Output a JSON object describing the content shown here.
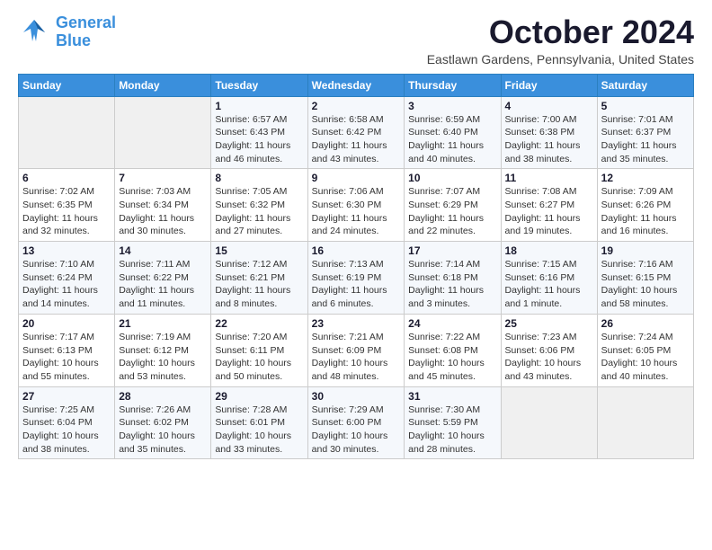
{
  "logo": {
    "line1": "General",
    "line2": "Blue"
  },
  "title": "October 2024",
  "location": "Eastlawn Gardens, Pennsylvania, United States",
  "weekdays": [
    "Sunday",
    "Monday",
    "Tuesday",
    "Wednesday",
    "Thursday",
    "Friday",
    "Saturday"
  ],
  "weeks": [
    [
      {
        "day": "",
        "info": ""
      },
      {
        "day": "",
        "info": ""
      },
      {
        "day": "1",
        "info": "Sunrise: 6:57 AM\nSunset: 6:43 PM\nDaylight: 11 hours and 46 minutes."
      },
      {
        "day": "2",
        "info": "Sunrise: 6:58 AM\nSunset: 6:42 PM\nDaylight: 11 hours and 43 minutes."
      },
      {
        "day": "3",
        "info": "Sunrise: 6:59 AM\nSunset: 6:40 PM\nDaylight: 11 hours and 40 minutes."
      },
      {
        "day": "4",
        "info": "Sunrise: 7:00 AM\nSunset: 6:38 PM\nDaylight: 11 hours and 38 minutes."
      },
      {
        "day": "5",
        "info": "Sunrise: 7:01 AM\nSunset: 6:37 PM\nDaylight: 11 hours and 35 minutes."
      }
    ],
    [
      {
        "day": "6",
        "info": "Sunrise: 7:02 AM\nSunset: 6:35 PM\nDaylight: 11 hours and 32 minutes."
      },
      {
        "day": "7",
        "info": "Sunrise: 7:03 AM\nSunset: 6:34 PM\nDaylight: 11 hours and 30 minutes."
      },
      {
        "day": "8",
        "info": "Sunrise: 7:05 AM\nSunset: 6:32 PM\nDaylight: 11 hours and 27 minutes."
      },
      {
        "day": "9",
        "info": "Sunrise: 7:06 AM\nSunset: 6:30 PM\nDaylight: 11 hours and 24 minutes."
      },
      {
        "day": "10",
        "info": "Sunrise: 7:07 AM\nSunset: 6:29 PM\nDaylight: 11 hours and 22 minutes."
      },
      {
        "day": "11",
        "info": "Sunrise: 7:08 AM\nSunset: 6:27 PM\nDaylight: 11 hours and 19 minutes."
      },
      {
        "day": "12",
        "info": "Sunrise: 7:09 AM\nSunset: 6:26 PM\nDaylight: 11 hours and 16 minutes."
      }
    ],
    [
      {
        "day": "13",
        "info": "Sunrise: 7:10 AM\nSunset: 6:24 PM\nDaylight: 11 hours and 14 minutes."
      },
      {
        "day": "14",
        "info": "Sunrise: 7:11 AM\nSunset: 6:22 PM\nDaylight: 11 hours and 11 minutes."
      },
      {
        "day": "15",
        "info": "Sunrise: 7:12 AM\nSunset: 6:21 PM\nDaylight: 11 hours and 8 minutes."
      },
      {
        "day": "16",
        "info": "Sunrise: 7:13 AM\nSunset: 6:19 PM\nDaylight: 11 hours and 6 minutes."
      },
      {
        "day": "17",
        "info": "Sunrise: 7:14 AM\nSunset: 6:18 PM\nDaylight: 11 hours and 3 minutes."
      },
      {
        "day": "18",
        "info": "Sunrise: 7:15 AM\nSunset: 6:16 PM\nDaylight: 11 hours and 1 minute."
      },
      {
        "day": "19",
        "info": "Sunrise: 7:16 AM\nSunset: 6:15 PM\nDaylight: 10 hours and 58 minutes."
      }
    ],
    [
      {
        "day": "20",
        "info": "Sunrise: 7:17 AM\nSunset: 6:13 PM\nDaylight: 10 hours and 55 minutes."
      },
      {
        "day": "21",
        "info": "Sunrise: 7:19 AM\nSunset: 6:12 PM\nDaylight: 10 hours and 53 minutes."
      },
      {
        "day": "22",
        "info": "Sunrise: 7:20 AM\nSunset: 6:11 PM\nDaylight: 10 hours and 50 minutes."
      },
      {
        "day": "23",
        "info": "Sunrise: 7:21 AM\nSunset: 6:09 PM\nDaylight: 10 hours and 48 minutes."
      },
      {
        "day": "24",
        "info": "Sunrise: 7:22 AM\nSunset: 6:08 PM\nDaylight: 10 hours and 45 minutes."
      },
      {
        "day": "25",
        "info": "Sunrise: 7:23 AM\nSunset: 6:06 PM\nDaylight: 10 hours and 43 minutes."
      },
      {
        "day": "26",
        "info": "Sunrise: 7:24 AM\nSunset: 6:05 PM\nDaylight: 10 hours and 40 minutes."
      }
    ],
    [
      {
        "day": "27",
        "info": "Sunrise: 7:25 AM\nSunset: 6:04 PM\nDaylight: 10 hours and 38 minutes."
      },
      {
        "day": "28",
        "info": "Sunrise: 7:26 AM\nSunset: 6:02 PM\nDaylight: 10 hours and 35 minutes."
      },
      {
        "day": "29",
        "info": "Sunrise: 7:28 AM\nSunset: 6:01 PM\nDaylight: 10 hours and 33 minutes."
      },
      {
        "day": "30",
        "info": "Sunrise: 7:29 AM\nSunset: 6:00 PM\nDaylight: 10 hours and 30 minutes."
      },
      {
        "day": "31",
        "info": "Sunrise: 7:30 AM\nSunset: 5:59 PM\nDaylight: 10 hours and 28 minutes."
      },
      {
        "day": "",
        "info": ""
      },
      {
        "day": "",
        "info": ""
      }
    ]
  ]
}
